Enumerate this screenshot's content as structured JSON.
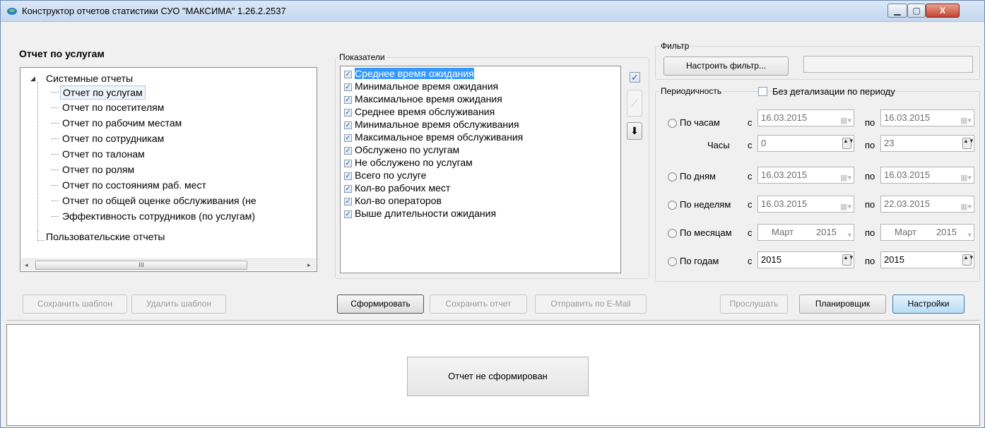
{
  "window": {
    "title": "Конструктор отчетов статистики СУО \"МАКСИМА\" 1.26.2.2537",
    "minimize_label": "▁",
    "maximize_label": "▢",
    "close_label": "X"
  },
  "left_panel": {
    "title": "Отчет по услугам",
    "tree": {
      "root_expand_glyph": "◢",
      "root": "Системные отчеты",
      "items": [
        "Отчет по услугам",
        "Отчет по посетителям",
        "Отчет по рабочим местам",
        "Отчет по сотрудникам",
        "Отчет по талонам",
        "Отчет по ролям",
        "Отчет по состояниям раб. мест",
        "Отчет по общей оценке обслуживания (не",
        "Эффективность сотрудников (по услугам)"
      ],
      "second_root": "Пользовательские отчеты",
      "selected_index": 0,
      "scroll_thumb_grip": "III",
      "scroll_left": "◂",
      "scroll_right": "▸"
    },
    "save_template_label": "Сохранить шаблон",
    "delete_template_label": "Удалить шаблон"
  },
  "indicators": {
    "group_label": "Показатели",
    "items": [
      "Среднее время ожидания",
      "Минимальное время ожидания",
      "Максимальное время ожидания",
      "Среднее время обслуживания",
      "Минимальное время обслуживания",
      "Максимальное время обслуживания",
      "Обслужено по услугам",
      "Не обслужено по услугам",
      "Всего по услуге",
      "Кол-во рабочих мест",
      "Кол-во операторов",
      "Выше длительности ожидания"
    ],
    "check_glyph": "✓",
    "select_all_glyph": "✓",
    "up_glyph": "⟋",
    "down_glyph": "⬇"
  },
  "actions": {
    "generate_label": "Сформировать",
    "save_report_label": "Сохранить отчет",
    "send_email_label": "Отправить по E-Mail",
    "listen_label": "Прослушать",
    "scheduler_label": "Планировщик",
    "settings_label": "Настройки"
  },
  "filter": {
    "group_label": "Фильтр",
    "configure_label": "Настроить фильтр...",
    "value": ""
  },
  "periodicity": {
    "label": "Периодичность",
    "no_detail_label": "Без детализации по периоду",
    "from_label": "с",
    "to_label": "по",
    "calendar_glyph": "▦▾",
    "spin_glyph": "▲▼",
    "rows": {
      "hours": {
        "label": "По часам",
        "from": "16.03.2015",
        "to": "16.03.2015"
      },
      "hours_time": {
        "label": "Часы",
        "from": "0",
        "to": "23"
      },
      "days": {
        "label": "По дням",
        "from": "16.03.2015",
        "to": "16.03.2015"
      },
      "weeks": {
        "label": "По неделям",
        "from": "16.03.2015",
        "to": "22.03.2015"
      },
      "months": {
        "label": "По месяцам",
        "from_month": "Март",
        "from_year": "2015",
        "to_month": "Март",
        "to_year": "2015",
        "dropdown_glyph": "▾"
      },
      "years": {
        "label": "По годам",
        "from": "2015",
        "to": "2015"
      }
    }
  },
  "report_area": {
    "placeholder": "Отчет не сформирован"
  },
  "colors": {
    "selection": "#3399ff",
    "accent_button": "#b9dcf5"
  }
}
